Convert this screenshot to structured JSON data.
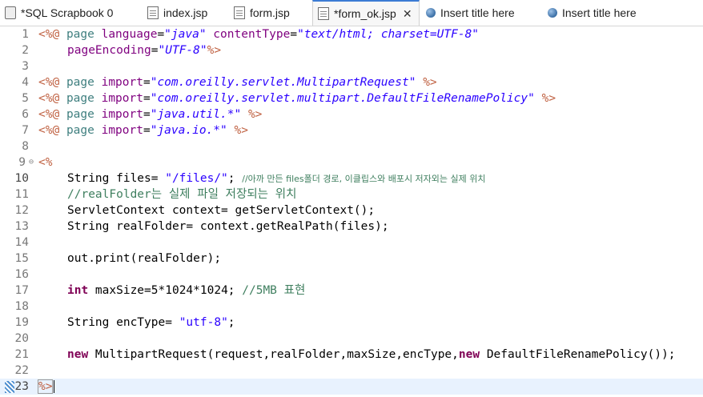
{
  "tabs": [
    {
      "label": "*SQL Scrapbook 0",
      "icon": "sql-scrapbook-icon",
      "active": false
    },
    {
      "label": "index.jsp",
      "icon": "jsp-file-icon",
      "active": false
    },
    {
      "label": "form.jsp",
      "icon": "jsp-file-icon",
      "active": false
    },
    {
      "label": "*form_ok.jsp",
      "icon": "jsp-file-icon",
      "active": true,
      "close": "✕"
    },
    {
      "label": "Insert title here",
      "icon": "browser-globe-icon",
      "active": false
    },
    {
      "label": "Insert title here",
      "icon": "browser-globe-icon",
      "active": false
    }
  ],
  "editor": {
    "current_line": 23,
    "line_numbers": [
      "1",
      "2",
      "3",
      "4",
      "5",
      "6",
      "7",
      "8",
      "9",
      "10",
      "11",
      "12",
      "13",
      "14",
      "15",
      "16",
      "17",
      "18",
      "19",
      "20",
      "21",
      "22",
      "23"
    ],
    "fold_marker": "⊖",
    "code": {
      "l1": {
        "open": "<%@",
        "kw": "page",
        "a1": "language",
        "eq1": "=",
        "v1": "\"java\"",
        "a2": "contentType",
        "eq2": "=",
        "v2": "\"text/html; charset=UTF-8\""
      },
      "l2": {
        "a1": "pageEncoding",
        "eq1": "=",
        "v1": "\"UTF-8\"",
        "close": "%>"
      },
      "l4": {
        "open": "<%@",
        "kw": "page",
        "a1": "import",
        "eq1": "=",
        "v1": "\"com.oreilly.servlet.MultipartRequest\"",
        "close": "%>"
      },
      "l5": {
        "open": "<%@",
        "kw": "page",
        "a1": "import",
        "eq1": "=",
        "v1": "\"com.oreilly.servlet.multipart.DefaultFileRenamePolicy\"",
        "close": "%>"
      },
      "l6": {
        "open": "<%@",
        "kw": "page",
        "a1": "import",
        "eq1": "=",
        "v1": "\"java.util.*\"",
        "close": "%>"
      },
      "l7": {
        "open": "<%@",
        "kw": "page",
        "a1": "import",
        "eq1": "=",
        "v1": "\"java.io.*\"",
        "close": "%>"
      },
      "l9": {
        "open": "<%"
      },
      "l10": {
        "t1": "String files= ",
        "s1": "\"/files/\"",
        "t2": "; ",
        "c1": "//아까 만든 files폴더 경로, 이클립스와 배포시 저자외는 실제 위치"
      },
      "l11": {
        "c1": "//realFolder는 실제 파일 저장되는 위치"
      },
      "l12": {
        "t1": "ServletContext context= getServletContext();"
      },
      "l13": {
        "t1": "String realFolder= context.getRealPath(files);"
      },
      "l15": {
        "t1": "out.print(realFolder);"
      },
      "l17": {
        "k1": "int",
        "t1": " maxSize=5*1024*1024; ",
        "c1": "//5MB 표현"
      },
      "l19": {
        "t1": "String encType= ",
        "s1": "\"utf-8\"",
        "t2": ";"
      },
      "l21": {
        "k1": "new",
        "t1": " MultipartRequest(request,realFolder,maxSize,encType,",
        "k2": "new",
        "t2": " DefaultFileRenamePolicy());"
      },
      "l23": {
        "close": "%>"
      }
    }
  },
  "colors": {
    "keyword": "#7f0055",
    "directive_bracket": "#bf5f3f",
    "directive_keyword": "#3f7f7f",
    "attribute": "#7f007f",
    "attribute_value": "#2a00ff",
    "string": "#2a00ff",
    "comment": "#3f7f5f",
    "current_line_bg": "#e8f2fe",
    "active_tab_accent": "#3c7bd4"
  }
}
